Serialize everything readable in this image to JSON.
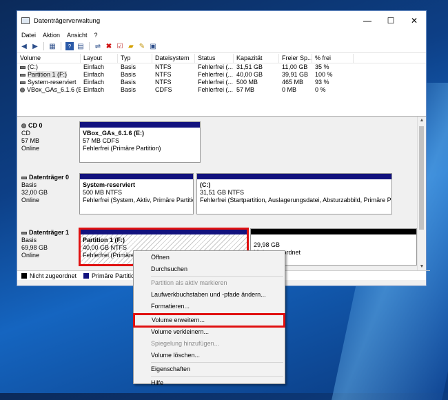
{
  "window": {
    "title": "Datenträgerverwaltung",
    "controls": [
      "—",
      "☐",
      "✕"
    ]
  },
  "menubar": [
    "Datei",
    "Aktion",
    "Ansicht",
    "?"
  ],
  "toolbar_icons": [
    "back-arrow-icon",
    "forward-arrow-icon",
    "properties-icon",
    "help-icon",
    "list-icon",
    "connect-icon",
    "delete-icon",
    "check-icon",
    "open-icon",
    "new-icon",
    "settings-icon"
  ],
  "volume_list": {
    "columns": [
      "Volume",
      "Layout",
      "Typ",
      "Dateisystem",
      "Status",
      "Kapazität",
      "Freier Sp...",
      "% frei"
    ],
    "rows": [
      [
        "(C:)",
        "Einfach",
        "Basis",
        "NTFS",
        "Fehlerfrei (...",
        "31,51 GB",
        "11,00 GB",
        "35 %"
      ],
      [
        "Partition 1 (F:)",
        "Einfach",
        "Basis",
        "NTFS",
        "Fehlerfrei (...",
        "40,00 GB",
        "39,91 GB",
        "100 %"
      ],
      [
        "System-reserviert",
        "Einfach",
        "Basis",
        "NTFS",
        "Fehlerfrei (...",
        "500 MB",
        "465 MB",
        "93 %"
      ],
      [
        "VBox_GAs_6.1.6 (E:)",
        "Einfach",
        "Basis",
        "CDFS",
        "Fehlerfrei (...",
        "57 MB",
        "0 MB",
        "0 %"
      ]
    ]
  },
  "disks": [
    {
      "name": "CD 0",
      "type": "CD",
      "size": "57 MB",
      "state": "Online",
      "partitions": [
        {
          "name": "VBox_GAs_6.1.6  (E:)",
          "size": "57 MB CDFS",
          "status": "Fehlerfrei (Primäre Partition)"
        }
      ]
    },
    {
      "name": "Datenträger 0",
      "type": "Basis",
      "size": "32,00 GB",
      "state": "Online",
      "partitions": [
        {
          "name": "System-reserviert",
          "size": "500 MB NTFS",
          "status": "Fehlerfrei (System, Aktiv, Primäre Partition)"
        },
        {
          "name": "(C:)",
          "size": "31,51 GB NTFS",
          "status": "Fehlerfrei (Startpartition, Auslagerungsdatei, Absturzabbild, Primäre Partit"
        }
      ]
    },
    {
      "name": "Datenträger 1",
      "type": "Basis",
      "size": "69,98 GB",
      "state": "Online",
      "partitions": [
        {
          "name": "Partition 1  (F:)",
          "size": "40,00 GB NTFS",
          "status": "Fehlerfrei (Primäre Partition)"
        },
        {
          "name": "",
          "size": "29,98 GB",
          "status": "Nicht zugeordnet"
        }
      ]
    }
  ],
  "legend": [
    {
      "label": "Nicht zugeordnet",
      "color": "#000000"
    },
    {
      "label": "Primäre Partition",
      "color": "#12127e"
    }
  ],
  "context_menu": {
    "items": [
      {
        "label": "Öffnen",
        "enabled": true
      },
      {
        "label": "Durchsuchen",
        "enabled": true
      },
      {
        "label": "Partition als aktiv markieren",
        "enabled": false
      },
      {
        "label": "Laufwerkbuchstaben und -pfade ändern...",
        "enabled": true
      },
      {
        "label": "Formatieren...",
        "enabled": true
      },
      {
        "label": "Volume erweitern...",
        "enabled": true,
        "highlighted": true
      },
      {
        "label": "Volume verkleinern...",
        "enabled": true
      },
      {
        "label": "Spiegelung hinzufügen...",
        "enabled": false
      },
      {
        "label": "Volume löschen...",
        "enabled": true
      },
      {
        "label": "Eigenschaften",
        "enabled": true
      },
      {
        "label": "Hilfe",
        "enabled": true
      }
    ]
  },
  "colors": {
    "primary_partition": "#12127e",
    "unallocated": "#000000",
    "highlight": "#e01010"
  }
}
